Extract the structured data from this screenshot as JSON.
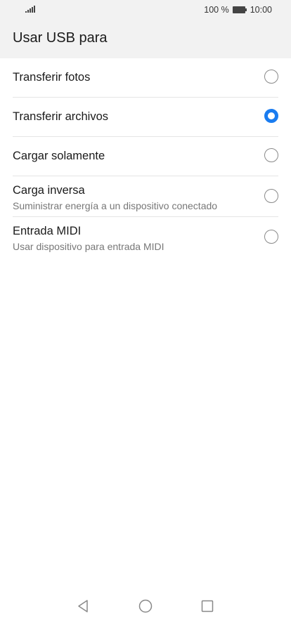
{
  "status_bar": {
    "battery_percent": "100 %",
    "time": "10:00"
  },
  "header": {
    "title": "Usar USB para"
  },
  "options": [
    {
      "label": "Transferir fotos",
      "subtitle": "",
      "selected": false
    },
    {
      "label": "Transferir archivos",
      "subtitle": "",
      "selected": true
    },
    {
      "label": "Cargar solamente",
      "subtitle": "",
      "selected": false
    },
    {
      "label": "Carga inversa",
      "subtitle": "Suministrar energía a un dispositivo conectado",
      "selected": false
    },
    {
      "label": "Entrada MIDI",
      "subtitle": "Usar dispositivo para entrada MIDI",
      "selected": false
    }
  ],
  "colors": {
    "accent": "#1a7cf0",
    "header_bg": "#f2f2f2"
  },
  "nav_icons": [
    "back-icon",
    "home-icon",
    "recents-icon"
  ]
}
